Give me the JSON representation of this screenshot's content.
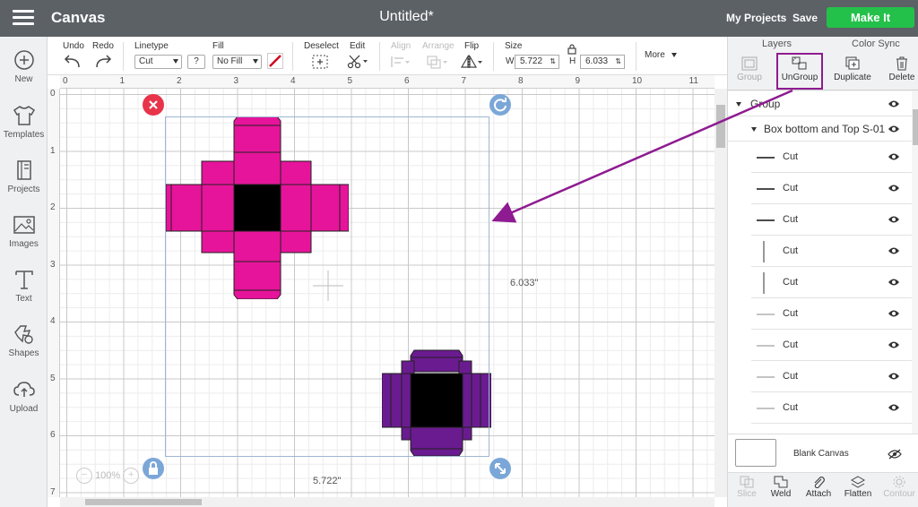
{
  "topbar": {
    "app_title": "Canvas",
    "doc_title": "Untitled*",
    "my_projects": "My Projects",
    "save": "Save",
    "make_it": "Make It"
  },
  "leftbar": {
    "items": [
      {
        "label": "New",
        "icon": "plus-circle-icon"
      },
      {
        "label": "Templates",
        "icon": "shirt-icon"
      },
      {
        "label": "Projects",
        "icon": "book-icon"
      },
      {
        "label": "Images",
        "icon": "image-icon"
      },
      {
        "label": "Text",
        "icon": "text-icon"
      },
      {
        "label": "Shapes",
        "icon": "shapes-icon"
      },
      {
        "label": "Upload",
        "icon": "cloud-upload-icon"
      }
    ]
  },
  "toolbar": {
    "undo": "Undo",
    "redo": "Redo",
    "linetype_label": "Linetype",
    "linetype_value": "Cut",
    "fill_label": "Fill",
    "fill_value": "No Fill",
    "help": "?",
    "deselect": "Deselect",
    "edit": "Edit",
    "align": "Align",
    "arrange": "Arrange",
    "flip": "Flip",
    "size_label": "Size",
    "w_label": "W",
    "w_value": "5.722",
    "h_label": "H",
    "h_value": "6.033",
    "more": "More",
    "accent_color": "#d0021b"
  },
  "canvas": {
    "ruler_top": [
      "0",
      "1",
      "2",
      "3",
      "4",
      "5",
      "6",
      "7",
      "8",
      "9",
      "10",
      "11"
    ],
    "ruler_left": [
      "0",
      "1",
      "2",
      "3",
      "4",
      "5",
      "6",
      "7"
    ],
    "height_label": "6.033\"",
    "width_label": "5.722\"",
    "zoom": "100%",
    "pink_color": "#e6149a",
    "purple_color": "#6a1b8f"
  },
  "rpanel": {
    "tabs": [
      "Layers",
      "Color Sync"
    ],
    "actions": [
      {
        "label": "Group",
        "enabled": false
      },
      {
        "label": "UnGroup",
        "enabled": true
      },
      {
        "label": "Duplicate",
        "enabled": true
      },
      {
        "label": "Delete",
        "enabled": true
      }
    ],
    "highlight_color": "#8e1b91",
    "group_label": "Group",
    "subgroup_label": "Box bottom and Top S-01",
    "layers": [
      "Cut",
      "Cut",
      "Cut",
      "Cut",
      "Cut",
      "Cut",
      "Cut",
      "Cut",
      "Cut"
    ],
    "blank_canvas": "Blank Canvas",
    "bottom": [
      {
        "label": "Slice",
        "enabled": false
      },
      {
        "label": "Weld",
        "enabled": true
      },
      {
        "label": "Attach",
        "enabled": true
      },
      {
        "label": "Flatten",
        "enabled": true
      },
      {
        "label": "Contour",
        "enabled": false
      }
    ]
  }
}
